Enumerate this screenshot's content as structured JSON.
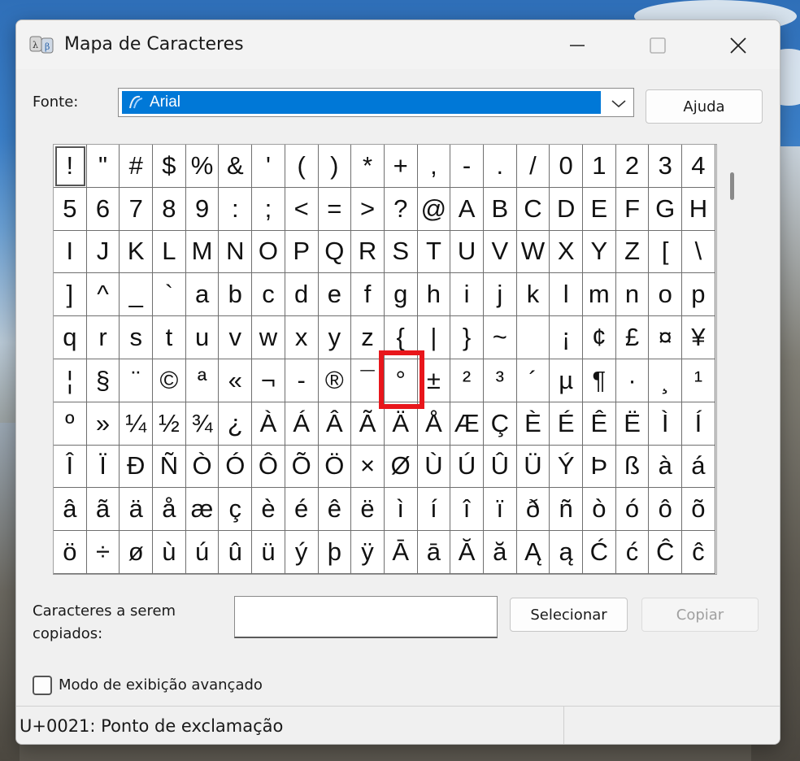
{
  "window": {
    "title": "Mapa de Caracteres",
    "icon": "charmap-app-icon",
    "controls": {
      "minimize": "minimize-icon",
      "maximize": "maximize-icon",
      "close": "close-icon"
    }
  },
  "font": {
    "label": "Fonte:",
    "selected": "Arial",
    "help_button": "Ajuda"
  },
  "grid": {
    "selected_index": 0,
    "highlighted_char": "°",
    "chars": [
      "!",
      "\"",
      "#",
      "$",
      "%",
      "&",
      "'",
      "(",
      ")",
      "*",
      "+",
      ",",
      "-",
      ".",
      "/",
      "0",
      "1",
      "2",
      "3",
      "4",
      "5",
      "6",
      "7",
      "8",
      "9",
      ":",
      ";",
      "<",
      "=",
      ">",
      "?",
      "@",
      "A",
      "B",
      "C",
      "D",
      "E",
      "F",
      "G",
      "H",
      "I",
      "J",
      "K",
      "L",
      "M",
      "N",
      "O",
      "P",
      "Q",
      "R",
      "S",
      "T",
      "U",
      "V",
      "W",
      "X",
      "Y",
      "Z",
      "[",
      "\\",
      "]",
      "^",
      "_",
      "`",
      "a",
      "b",
      "c",
      "d",
      "e",
      "f",
      "g",
      "h",
      "i",
      "j",
      "k",
      "l",
      "m",
      "n",
      "o",
      "p",
      "q",
      "r",
      "s",
      "t",
      "u",
      "v",
      "w",
      "x",
      "y",
      "z",
      "{",
      "|",
      "}",
      "~",
      " ",
      "¡",
      "¢",
      "£",
      "¤",
      "¥",
      "¦",
      "§",
      "¨",
      "©",
      "ª",
      "«",
      "¬",
      "-",
      "®",
      "¯",
      "°",
      "±",
      "²",
      "³",
      "´",
      "µ",
      "¶",
      "·",
      "¸",
      "¹",
      "º",
      "»",
      "¼",
      "½",
      "¾",
      "¿",
      "À",
      "Á",
      "Â",
      "Ã",
      "Ä",
      "Å",
      "Æ",
      "Ç",
      "È",
      "É",
      "Ê",
      "Ë",
      "Ì",
      "Í",
      "Î",
      "Ï",
      "Ð",
      "Ñ",
      "Ò",
      "Ó",
      "Ô",
      "Õ",
      "Ö",
      "×",
      "Ø",
      "Ù",
      "Ú",
      "Û",
      "Ü",
      "Ý",
      "Þ",
      "ß",
      "à",
      "á",
      "â",
      "ã",
      "ä",
      "å",
      "æ",
      "ç",
      "è",
      "é",
      "ê",
      "ë",
      "ì",
      "í",
      "î",
      "ï",
      "ð",
      "ñ",
      "ò",
      "ó",
      "ô",
      "õ",
      "ö",
      "÷",
      "ø",
      "ù",
      "ú",
      "û",
      "ü",
      "ý",
      "þ",
      "ÿ",
      "Ā",
      "ā",
      "Ă",
      "ă",
      "Ą",
      "ą",
      "Ć",
      "ć",
      "Ĉ",
      "ĉ"
    ]
  },
  "copy": {
    "label": "Caracteres a serem copiados:",
    "value": "",
    "select_button": "Selecionar",
    "copy_button": "Copiar"
  },
  "advanced": {
    "label": "Modo de exibição avançado",
    "checked": false
  },
  "status": {
    "text": "U+0021: Ponto de exclamação"
  },
  "colors": {
    "selection": "#0078d7",
    "highlight_box": "#e8161b"
  }
}
